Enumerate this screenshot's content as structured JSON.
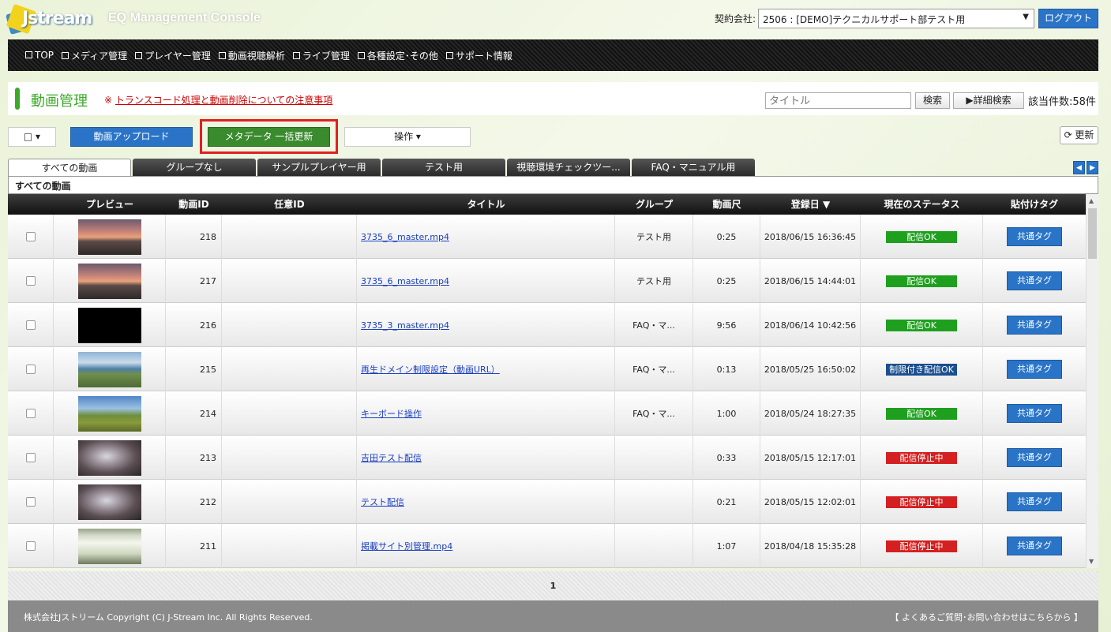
{
  "header": {
    "logo_text": "Jstream",
    "app_title": "EQ Management Console",
    "contract_label": "契約会社:",
    "contract_value": "2506 : [DEMO]テクニカルサポート部テスト用",
    "logout_label": "ログアウト"
  },
  "nav": {
    "items": [
      "TOP",
      "メディア管理",
      "プレイヤー管理",
      "動画視聴解析",
      "ライブ管理",
      "各種設定･その他",
      "サポート情報"
    ]
  },
  "page": {
    "title": "動画管理",
    "notice_prefix": "※",
    "notice_link": "トランスコード処理と動画削除についての注意事項",
    "search_placeholder": "タイトル",
    "search_label": "検索",
    "advanced_search_label": "▶詳細検索",
    "result_count": "該当件数:58件"
  },
  "toolbar": {
    "select_all_label": "□ ▾",
    "upload_label": "動画アップロード",
    "metadata_label": "メタデータ 一括更新",
    "operations_label": "操作 ▾",
    "refresh_label": "⟳ 更新"
  },
  "tabs": [
    {
      "label": "すべての動画",
      "active": true
    },
    {
      "label": "グループなし",
      "active": false
    },
    {
      "label": "サンプルプレイヤー用",
      "active": false
    },
    {
      "label": "テスト用",
      "active": false
    },
    {
      "label": "視聴環境チェックツー...",
      "active": false
    },
    {
      "label": "FAQ・マニュアル用",
      "active": false
    }
  ],
  "section_title": "すべての動画",
  "table": {
    "columns": [
      "",
      "プレビュー",
      "動画ID",
      "任意ID",
      "タイトル",
      "グループ",
      "動画尺",
      "登録日 ▼",
      "現在のステータス",
      "貼付けタグ"
    ],
    "rows": [
      {
        "id": "218",
        "title": "3735_6_master.mp4",
        "group": "テスト用",
        "duration": "0:25",
        "date": "2018/06/15 16:36:45",
        "status": "配信OK",
        "status_color": "#1ea01e",
        "tag": "共通タグ",
        "thumb": "sunset"
      },
      {
        "id": "217",
        "title": "3735_6_master.mp4",
        "group": "テスト用",
        "duration": "0:25",
        "date": "2018/06/15 14:44:01",
        "status": "配信OK",
        "status_color": "#1ea01e",
        "tag": "共通タグ",
        "thumb": "sunset"
      },
      {
        "id": "216",
        "title": "3735_3_master.mp4",
        "group": "FAQ・マ...",
        "duration": "9:56",
        "date": "2018/06/14 10:42:56",
        "status": "配信OK",
        "status_color": "#1ea01e",
        "tag": "共通タグ",
        "thumb": "black"
      },
      {
        "id": "215",
        "title": "再生ドメイン制限設定（動画URL）",
        "group": "FAQ・マ...",
        "duration": "0:13",
        "date": "2018/05/25 16:50:02",
        "status": "制限付き配信OK",
        "status_color": "#1b4f8f",
        "tag": "共通タグ",
        "thumb": "coast"
      },
      {
        "id": "214",
        "title": "キーボード操作",
        "group": "FAQ・マ...",
        "duration": "1:00",
        "date": "2018/05/24 18:27:35",
        "status": "配信OK",
        "status_color": "#1ea01e",
        "tag": "共通タグ",
        "thumb": "field"
      },
      {
        "id": "213",
        "title": "吉田テスト配信",
        "group": "",
        "duration": "0:33",
        "date": "2018/05/15 12:17:01",
        "status": "配信停止中",
        "status_color": "#d42020",
        "tag": "共通タグ",
        "thumb": "cat"
      },
      {
        "id": "212",
        "title": "テスト配信",
        "group": "",
        "duration": "0:21",
        "date": "2018/05/15 12:02:01",
        "status": "配信停止中",
        "status_color": "#d42020",
        "tag": "共通タグ",
        "thumb": "cat"
      },
      {
        "id": "211",
        "title": "掲載サイト別管理.mp4",
        "group": "",
        "duration": "1:07",
        "date": "2018/04/18 15:35:28",
        "status": "配信停止中",
        "status_color": "#d42020",
        "tag": "共通タグ",
        "thumb": "screen"
      }
    ]
  },
  "pager": {
    "current": "1"
  },
  "footer": {
    "copyright": "株式会社Jストリーム  Copyright (C) J-Stream Inc. All Rights Reserved.",
    "faq": "【 よくあるご質問･お問い合わせはこちらから 】"
  },
  "colors": {
    "accent_blue": "#2a74c8",
    "accent_green": "#3ea82a",
    "status_ok": "#1ea01e",
    "status_limited": "#1b4f8f",
    "status_stopped": "#d42020"
  }
}
